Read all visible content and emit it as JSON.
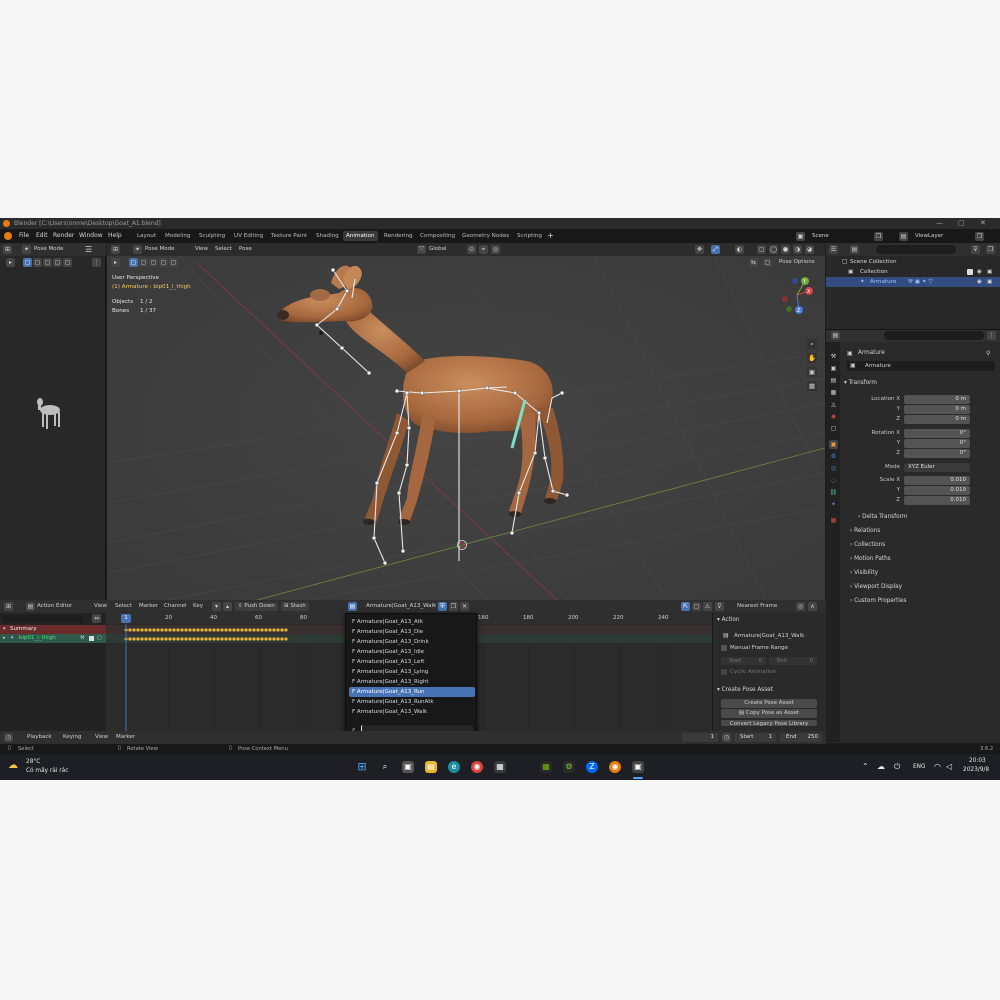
{
  "window": {
    "title": "Blender [C:\\Users\\nnme\\Desktop\\Goat_A1.blend]",
    "minimize": "—",
    "maximize": "▢",
    "close": "✕"
  },
  "menu": [
    "File",
    "Edit",
    "Render",
    "Window",
    "Help"
  ],
  "workspaces": [
    "Layout",
    "Modeling",
    "Sculpting",
    "UV Editing",
    "Texture Paint",
    "Shading",
    "Animation",
    "Rendering",
    "Compositing",
    "Geometry Nodes",
    "Scripting"
  ],
  "active_workspace": "Animation",
  "scene": {
    "name": "Scene",
    "view_layer": "ViewLayer"
  },
  "left_panel": {
    "mode": "Pose Mode"
  },
  "viewport": {
    "mode": "Pose Mode",
    "menus": [
      "View",
      "Select",
      "Pose"
    ],
    "orientation": "Global",
    "pose_options": "Pose Options",
    "perspective": "User Perspective",
    "active": "(1) Armature : bip01_l_thigh",
    "objects_label": "Objects",
    "objects_value": "1 / 2",
    "bones_label": "Bones",
    "bones_value": "1 / 37",
    "gizmo": {
      "x": "X",
      "y": "Y",
      "z": "Z"
    }
  },
  "outliner": {
    "search_placeholder": "",
    "rows": [
      {
        "label": "Scene Collection"
      },
      {
        "label": "Collection"
      },
      {
        "label": "Armature"
      }
    ]
  },
  "properties": {
    "object_name": "Armature",
    "data_name": "Armature",
    "transform_title": "Transform",
    "location": {
      "label": "Location X",
      "x": "0 m",
      "y": "0 m",
      "z": "0 m"
    },
    "rotation": {
      "label": "Rotation X",
      "x": "0°",
      "y": "0°",
      "z": "0°"
    },
    "mode_label": "Mode",
    "mode_value": "XYZ Euler",
    "scale": {
      "label": "Scale X",
      "x": "0.010",
      "y": "0.010",
      "z": "0.010"
    },
    "axis_y": "Y",
    "axis_z": "Z",
    "delta": "Delta Transform",
    "sections": [
      "Relations",
      "Collections",
      "Motion Paths",
      "Visibility",
      "Viewport Display",
      "Custom Properties"
    ]
  },
  "action_editor": {
    "editor": "Action Editor",
    "menus": [
      "View",
      "Select",
      "Marker",
      "Channel",
      "Key"
    ],
    "push_down": "Push Down",
    "stash": "Stash",
    "action": "Armature|Goat_A13_Walk",
    "snapping": "Nearest Frame",
    "frames": [
      "1",
      "20",
      "40",
      "60",
      "80",
      "160",
      "180",
      "200",
      "220",
      "240"
    ],
    "current_frame": "1",
    "channels": {
      "summary": "Summary",
      "bone": "bip01_l_thigh"
    }
  },
  "action_panel": {
    "title": "Action",
    "action_name": "Armature|Goat_A13_Walk",
    "manual_range": "Manual Frame Range",
    "start_label": "Start",
    "start_value": "0",
    "end_label": "End",
    "end_value": "0",
    "cyclic": "Cyclic Animation",
    "pose_asset_title": "Create Pose Asset",
    "create_pose_asset": "Create Pose Asset",
    "copy_pose": "Copy Pose as Asset",
    "convert_legacy": "Convert Legacy Pose Library"
  },
  "dropdown": {
    "items": [
      "F Armature|Goat_A13_Atk",
      "F Armature|Goat_A13_Die",
      "F Armature|Goat_A13_Drink",
      "F Armature|Goat_A13_Idle",
      "F Armature|Goat_A13_Left",
      "F Armature|Goat_A13_Lying",
      "F Armature|Goat_A13_Right",
      "F Armature|Goat_A13_Run",
      "F Armature|Goat_A13_RunAtk",
      "F Armature|Goat_A13_Walk"
    ],
    "selected_index": 7
  },
  "timeline": {
    "menus": [
      "Playback",
      "Keying",
      "View",
      "Marker"
    ],
    "current": "1",
    "start_label": "Start",
    "start": "1",
    "end_label": "End",
    "end": "250"
  },
  "statusbar": {
    "select": "Select",
    "rotate": "Rotate View",
    "context": "Pose Context Menu",
    "version": "3.6.2"
  },
  "taskbar": {
    "weather_temp": "28°C",
    "weather_desc": "Có mây rải rác",
    "lang": "ENG",
    "time": "20:03",
    "date": "2023/9/8"
  },
  "colors": {
    "accent": "#4772b3",
    "selected_bone": "#79e0c9",
    "keyframe": "#e3b23c",
    "summary_bg": "#6b2b2b",
    "channel_bg": "#2f5a4b"
  }
}
